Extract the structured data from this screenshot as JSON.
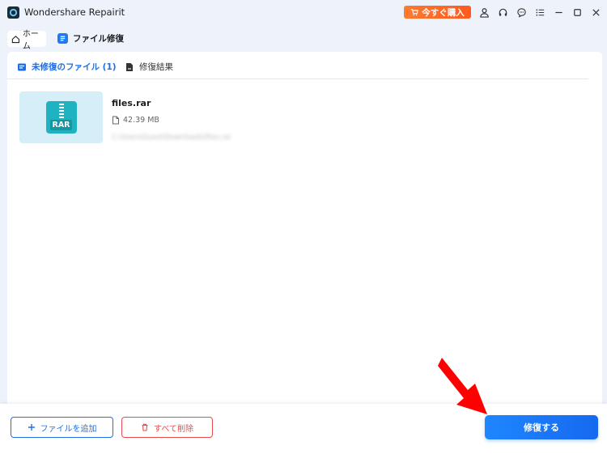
{
  "app": {
    "title": "Wondershare Repairit",
    "buy_label": "今すぐ購入"
  },
  "titlebar_icons": [
    "user-icon",
    "headset-icon",
    "chat-icon",
    "menu-icon",
    "minimize-icon",
    "maximize-icon",
    "close-icon"
  ],
  "nav": {
    "home_label": "ホーム",
    "repair_label": "ファイル修復"
  },
  "tabs": {
    "unrepaired_label": "未修復のファイル (1)",
    "result_label": "修復結果"
  },
  "file": {
    "name": "files.rar",
    "size": "42.39 MB",
    "path": "C:\\Users\\Guest\\Downloads\\files.rar",
    "type_label": "RAR"
  },
  "actions": {
    "add_label": "ファイルを追加",
    "delete_label": "すべて削除",
    "repair_label": "修復する"
  },
  "colors": {
    "accent": "#1e6fe6",
    "buy": "#ff6a26",
    "danger": "#e84b4b",
    "annotation_arrow": "#ff0000"
  }
}
